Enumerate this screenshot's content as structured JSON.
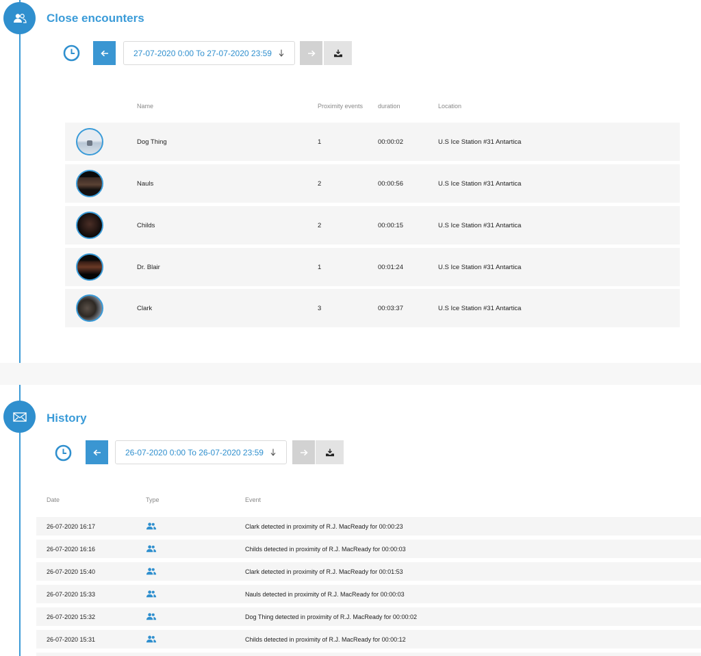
{
  "colors": {
    "accent": "#3a9bd8",
    "row_bg": "#f5f5f5",
    "next_disabled": "#d2d2d2"
  },
  "close_encounters": {
    "title": "Close encounters",
    "badge_icon": "people-icon",
    "date_range": "27-07-2020 0:00 To 27-07-2020 23:59",
    "columns": {
      "name": "Name",
      "proximity": "Proximity events",
      "duration": "duration",
      "location": "Location"
    },
    "rows": [
      {
        "name": "Dog Thing",
        "proximity": "1",
        "duration": "00:00:02",
        "location": "U.S Ice Station #31 Antartica"
      },
      {
        "name": "Nauls",
        "proximity": "2",
        "duration": "00:00:56",
        "location": "U.S Ice Station #31 Antartica"
      },
      {
        "name": "Childs",
        "proximity": "2",
        "duration": "00:00:15",
        "location": "U.S Ice Station #31 Antartica"
      },
      {
        "name": "Dr. Blair",
        "proximity": "1",
        "duration": "00:01:24",
        "location": "U.S Ice Station #31 Antartica"
      },
      {
        "name": "Clark",
        "proximity": "3",
        "duration": "00:03:37",
        "location": "U.S Ice Station #31 Antartica"
      }
    ]
  },
  "history": {
    "title": "History",
    "badge_icon": "envelope-icon",
    "date_range": "26-07-2020 0:00 To 26-07-2020 23:59",
    "columns": {
      "date": "Date",
      "type": "Type",
      "event": "Event"
    },
    "rows": [
      {
        "date": "26-07-2020 16:17",
        "type_icon": "people-icon",
        "event": "Clark detected in proximity of R.J. MacReady for 00:00:23"
      },
      {
        "date": "26-07-2020 16:16",
        "type_icon": "people-icon",
        "event": "Childs detected in proximity of R.J. MacReady for 00:00:03"
      },
      {
        "date": "26-07-2020 15:40",
        "type_icon": "people-icon",
        "event": "Clark detected in proximity of R.J. MacReady for 00:01:53"
      },
      {
        "date": "26-07-2020 15:33",
        "type_icon": "people-icon",
        "event": "Nauls detected in proximity of R.J. MacReady for 00:00:03"
      },
      {
        "date": "26-07-2020 15:32",
        "type_icon": "people-icon",
        "event": "Dog Thing detected in proximity of R.J. MacReady for 00:00:02"
      },
      {
        "date": "26-07-2020 15:31",
        "type_icon": "people-icon",
        "event": "Childs detected in proximity of R.J. MacReady for 00:00:12"
      }
    ]
  }
}
